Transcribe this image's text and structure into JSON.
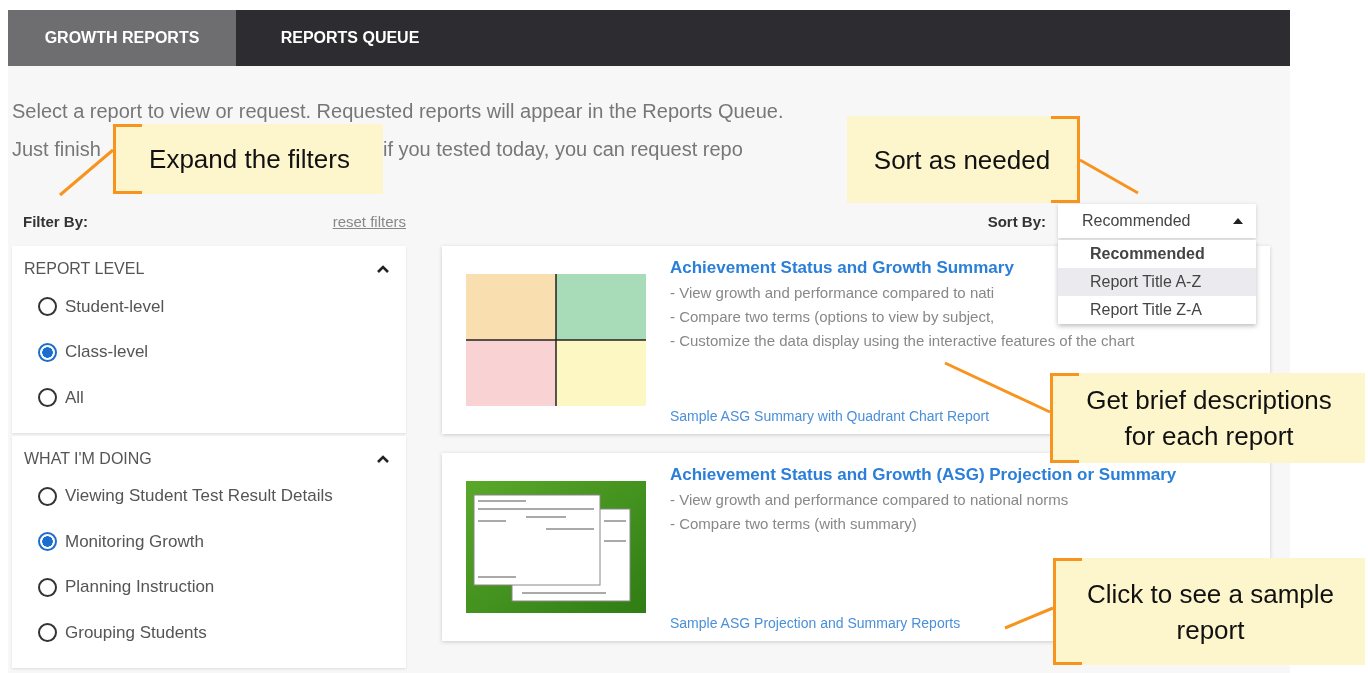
{
  "tabs": [
    {
      "label": "GROWTH REPORTS",
      "selected": true
    },
    {
      "label": "REPORTS QUEUE",
      "selected": false
    }
  ],
  "intro": {
    "line_1": "Select a report to view or request. Requested reports will appear in the Reports Queue.",
    "line_2_start": "Just finish",
    "line_2_end": "if you tested today, you can request repo"
  },
  "filters": {
    "label": "Filter By:",
    "reset": "reset filters",
    "groups": [
      {
        "title": "REPORT LEVEL",
        "expanded": true,
        "options": [
          {
            "label": "Student-level",
            "selected": false
          },
          {
            "label": "Class-level",
            "selected": true
          },
          {
            "label": "All",
            "selected": false
          }
        ]
      },
      {
        "title": "WHAT I'M DOING",
        "expanded": true,
        "options": [
          {
            "label": "Viewing Student Test Result Details",
            "selected": false
          },
          {
            "label": "Monitoring Growth",
            "selected": true
          },
          {
            "label": "Planning Instruction",
            "selected": false
          },
          {
            "label": "Grouping Students",
            "selected": false
          }
        ]
      }
    ]
  },
  "sort": {
    "label": "Sort By:",
    "value": "Recommended",
    "open": true,
    "options": [
      {
        "label": "Recommended",
        "selected": true,
        "highlighted": false
      },
      {
        "label": "Report Title A-Z",
        "selected": false,
        "highlighted": true
      },
      {
        "label": "Report Title Z-A",
        "selected": false,
        "highlighted": false
      }
    ]
  },
  "reports": [
    {
      "kind": "quadrant",
      "title": "Achievement Status and Growth Summary",
      "descriptions": [
        "- View growth and performance compared to nati",
        "- Compare two terms (options to view by subject,",
        "- Customize the data display using the interactive features of the chart"
      ],
      "sample_link": "Sample ASG Summary with Quadrant Chart Report"
    },
    {
      "kind": "document",
      "title": "Achievement Status and Growth (ASG) Projection or Summary",
      "descriptions": [
        "- View growth and performance compared to national norms",
        "- Compare two terms (with summary)"
      ],
      "sample_link": "Sample ASG Projection and Summary Reports"
    }
  ],
  "callouts": [
    {
      "text": "Expand the filters"
    },
    {
      "text": "Sort as needed"
    },
    {
      "text": "Get brief descriptions for each report"
    },
    {
      "text": "Click to see a sample report"
    }
  ]
}
